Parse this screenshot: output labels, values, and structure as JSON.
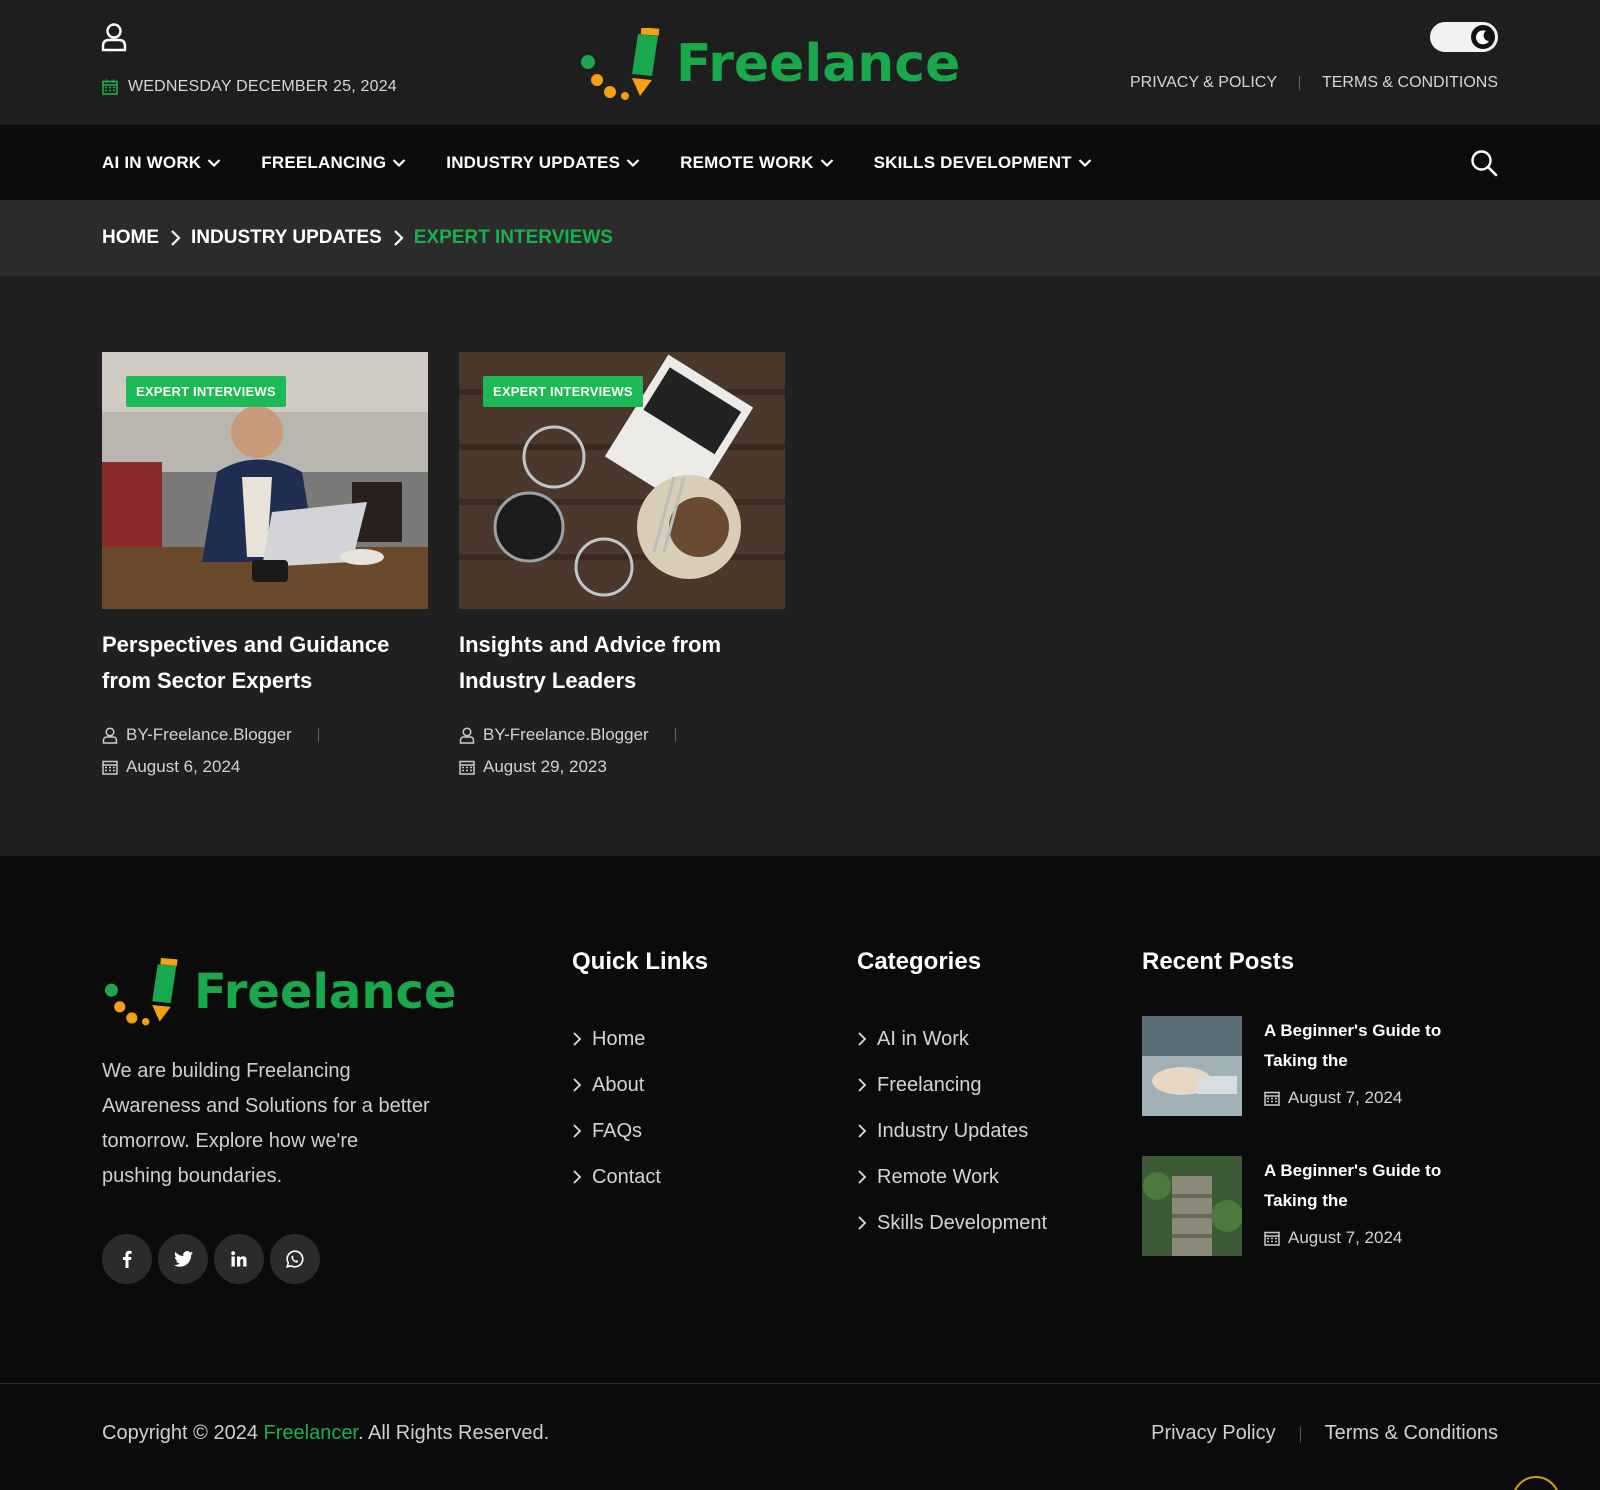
{
  "header": {
    "date": "WEDNESDAY DECEMBER 25, 2024",
    "logo_text": "Freelance",
    "top_links": [
      "PRIVACY & POLICY",
      "TERMS & CONDITIONS"
    ]
  },
  "nav": {
    "items": [
      "AI IN WORK",
      "FREELANCING",
      "INDUSTRY UPDATES",
      "REMOTE WORK",
      "SKILLS DEVELOPMENT"
    ]
  },
  "breadcrumb": {
    "home": "HOME",
    "parent": "INDUSTRY UPDATES",
    "current": "EXPERT INTERVIEWS"
  },
  "posts": [
    {
      "badge": "EXPERT INTERVIEWS",
      "title": "Perspectives and Guidance from Sector Experts",
      "author": "BY-Freelance.Blogger",
      "date": "August 6, 2024"
    },
    {
      "badge": "EXPERT INTERVIEWS",
      "title": "Insights and Advice from Industry Leaders",
      "author": "BY-Freelance.Blogger",
      "date": "August 29, 2023"
    }
  ],
  "footer": {
    "logo_text": "Freelance",
    "about": "We are building Freelancing Awareness and Solutions for a better tomorrow. Explore how we're pushing boundaries.",
    "quick_links_title": "Quick Links",
    "quick_links": [
      "Home",
      "About",
      "FAQs",
      "Contact"
    ],
    "categories_title": "Categories",
    "categories": [
      "AI in Work",
      "Freelancing",
      "Industry Updates",
      "Remote Work",
      "Skills Development"
    ],
    "recent_title": "Recent Posts",
    "recent_posts": [
      {
        "title": "A Beginner's Guide to Taking the",
        "date": "August 7, 2024"
      },
      {
        "title": "A Beginner's Guide to Taking the",
        "date": "August 7, 2024"
      }
    ],
    "copyright_prefix": "Copyright © 2024 ",
    "copyright_brand": "Freelancer",
    "copyright_suffix": ". All Rights Reserved.",
    "bottom_links": [
      "Privacy Policy",
      "Terms & Conditions"
    ]
  },
  "colors": {
    "accent": "#19b04f",
    "logo_orange": "#f5a011"
  }
}
